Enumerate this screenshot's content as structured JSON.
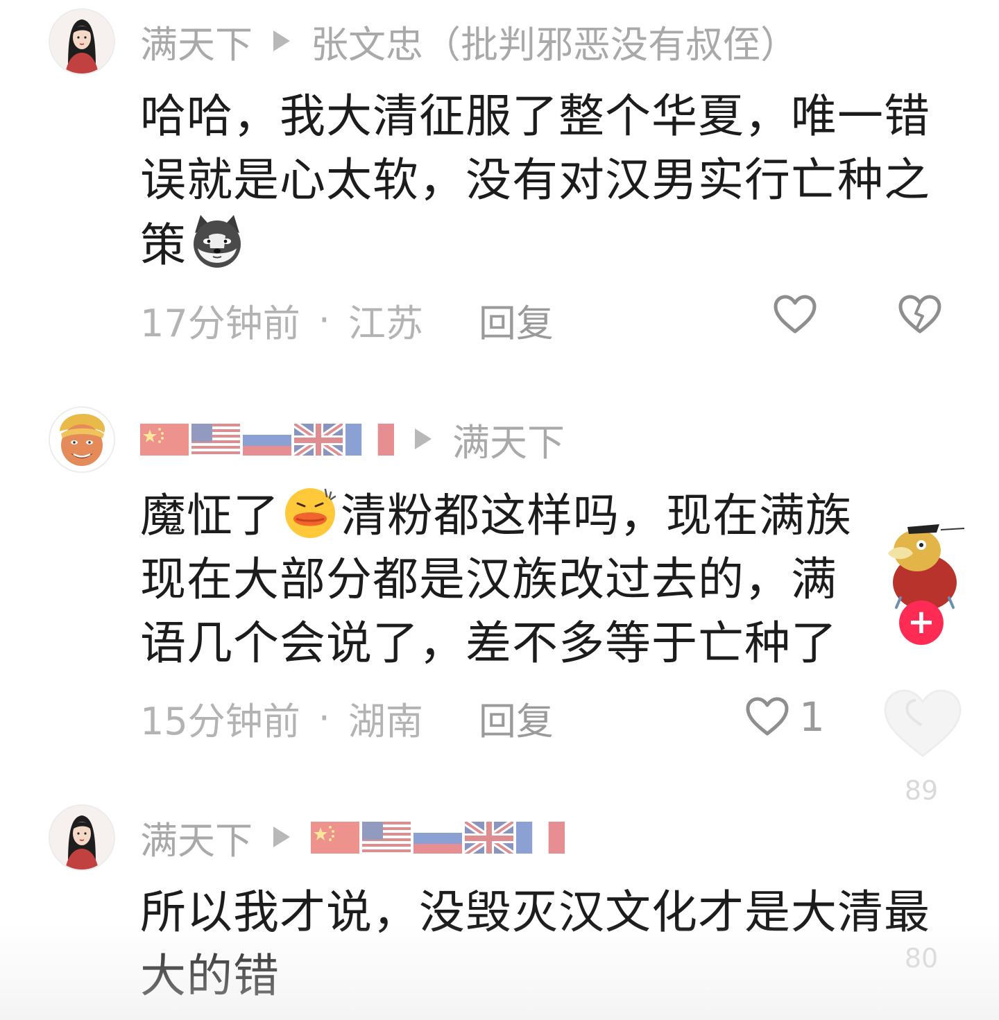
{
  "comments": [
    {
      "author": "满天下",
      "reply_to": "张文忠（批判邪恶没有叔侄）",
      "text_before_emoji": "哈哈，我大清征服了整个华夏，唯一错误就是心太软，没有对汉男实行亡种之策",
      "emoji": "husky-dog-emoji",
      "text_after_emoji": "",
      "time": "17分钟前",
      "location": "江苏",
      "reply_label": "回复",
      "like_count": ""
    },
    {
      "author_flags": [
        "china-flag",
        "usa-flag",
        "russia-flag",
        "uk-flag",
        "france-flag"
      ],
      "reply_to": "满天下",
      "text_before_emoji": "魔怔了",
      "emoji": "duck-emoji",
      "text_after_emoji": "清粉都这样吗，现在满族现在大部分都是汉族改过去的，满语几个会说了，差不多等于亡种了",
      "time": "15分钟前",
      "location": "湖南",
      "reply_label": "回复",
      "like_count": "1"
    },
    {
      "author": "满天下",
      "reply_to_flags": [
        "china-flag",
        "usa-flag",
        "russia-flag",
        "uk-flag",
        "france-flag"
      ],
      "text": "所以我才说，没毁灭汉文化才是大清最大的错"
    }
  ],
  "side_overlay": {
    "like_count": "89",
    "share_count": "80",
    "follow_label": "+"
  },
  "colors": {
    "meta_gray": "#b3b3b3",
    "body_text": "#1c1c1c",
    "follow_red": "#fe2c55"
  }
}
